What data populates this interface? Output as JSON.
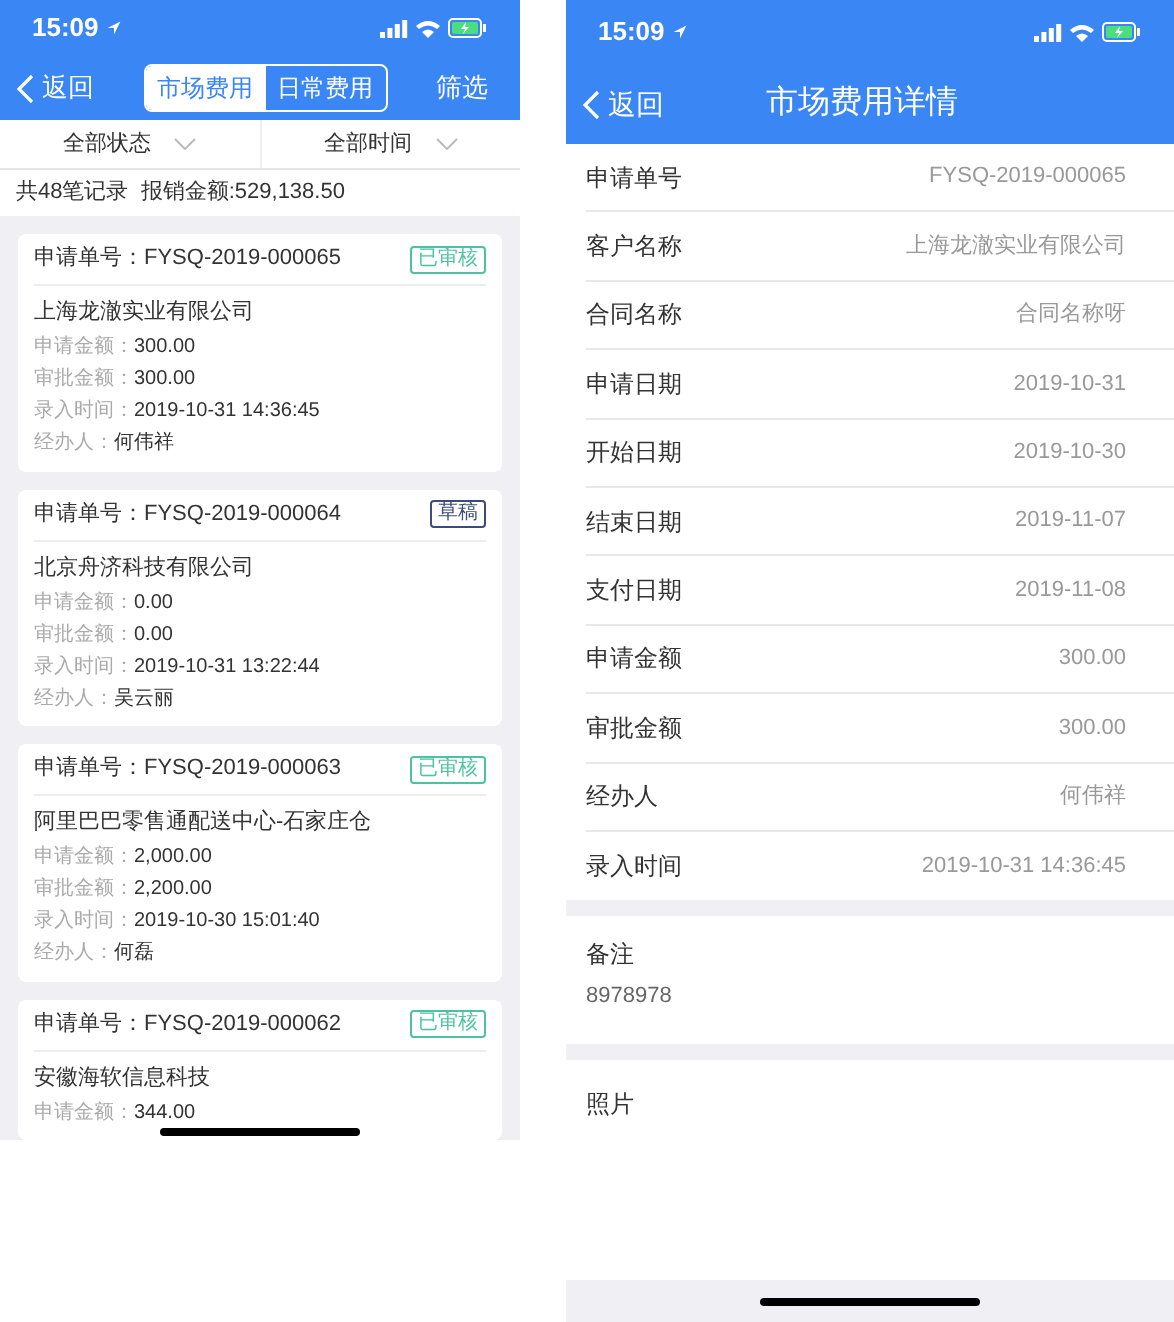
{
  "list_screen": {
    "status_bar": {
      "time": "15:09"
    },
    "nav": {
      "back": "返回",
      "tabs": [
        {
          "label": "市场费用",
          "selected": true
        },
        {
          "label": "日常费用",
          "selected": false
        }
      ],
      "action": "筛选"
    },
    "filters": [
      "全部状态",
      "全部时间"
    ],
    "summary": "共48笔记录  报销金额:529,138.50",
    "cards": [
      {
        "number": "申请单号：FYSQ-2019-000065",
        "status": {
          "text": "已审核",
          "color": "#4cc3a0"
        },
        "company": "上海龙澈实业有限公司",
        "fields": [
          {
            "label": "申请金额：",
            "value": "300.00"
          },
          {
            "label": "审批金额：",
            "value": "300.00"
          },
          {
            "label": "录入时间：",
            "value": "2019-10-31 14:36:45"
          },
          {
            "label": "经办人：",
            "value": "何伟祥"
          }
        ]
      },
      {
        "number": "申请单号：FYSQ-2019-000064",
        "status": {
          "text": "草稿",
          "color": "#3d4a7a"
        },
        "company": "北京舟济科技有限公司",
        "fields": [
          {
            "label": "申请金额：",
            "value": "0.00"
          },
          {
            "label": "审批金额：",
            "value": "0.00"
          },
          {
            "label": "录入时间：",
            "value": "2019-10-31 13:22:44"
          },
          {
            "label": "经办人：",
            "value": "吴云丽"
          }
        ]
      },
      {
        "number": "申请单号：FYSQ-2019-000063",
        "status": {
          "text": "已审核",
          "color": "#4cc3a0"
        },
        "company": "阿里巴巴零售通配送中心-石家庄仓",
        "fields": [
          {
            "label": "申请金额：",
            "value": "2,000.00"
          },
          {
            "label": "审批金额：",
            "value": "2,200.00"
          },
          {
            "label": "录入时间：",
            "value": "2019-10-30 15:01:40"
          },
          {
            "label": "经办人：",
            "value": "何磊"
          }
        ]
      },
      {
        "number": "申请单号：FYSQ-2019-000062",
        "status": {
          "text": "已审核",
          "color": "#4cc3a0"
        },
        "company": "安徽海软信息科技",
        "fields": [
          {
            "label": "申请金额：",
            "value": "344.00"
          }
        ]
      }
    ]
  },
  "detail_screen": {
    "status_bar": {
      "time": "15:09"
    },
    "nav": {
      "back": "返回",
      "title": "市场费用详情"
    },
    "rows": [
      {
        "label": "申请单号",
        "value": "FYSQ-2019-000065"
      },
      {
        "label": "客户名称",
        "value": "上海龙澈实业有限公司"
      },
      {
        "label": "合同名称",
        "value": "合同名称呀"
      },
      {
        "label": "申请日期",
        "value": "2019-10-31"
      },
      {
        "label": "开始日期",
        "value": "2019-10-30"
      },
      {
        "label": "结束日期",
        "value": "2019-11-07"
      },
      {
        "label": "支付日期",
        "value": "2019-11-08"
      },
      {
        "label": "申请金额",
        "value": "300.00"
      },
      {
        "label": "审批金额",
        "value": "300.00"
      },
      {
        "label": "经办人",
        "value": "何伟祥"
      },
      {
        "label": "录入时间",
        "value": "2019-10-31 14:36:45"
      }
    ],
    "remark": {
      "label": "备注",
      "value": "8978978"
    },
    "photos": {
      "label": "照片"
    }
  }
}
